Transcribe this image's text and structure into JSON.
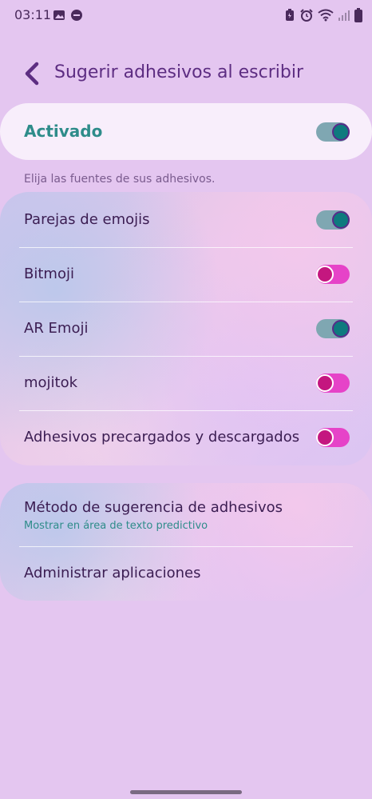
{
  "status_bar": {
    "time": "03:11"
  },
  "header": {
    "title": "Sugerir adhesivos al escribir"
  },
  "master": {
    "label": "Activado",
    "on": true
  },
  "section_hint": "Elija las fuentes de sus adhesivos.",
  "sources": [
    {
      "label": "Parejas de emojis",
      "on": true
    },
    {
      "label": "Bitmoji",
      "on": false
    },
    {
      "label": "AR Emoji",
      "on": true
    },
    {
      "label": "mojitok",
      "on": false
    },
    {
      "label": "Adhesivos precargados y descargados",
      "on": false
    }
  ],
  "settings": [
    {
      "label": "Método de sugerencia de adhesivos",
      "sub": "Mostrar en área de texto predictivo"
    },
    {
      "label": "Administrar aplicaciones"
    }
  ],
  "colors": {
    "background": "#e4c6f0",
    "accent_teal": "#2e8c8a",
    "title_purple": "#5d2d82",
    "toggle_off": "#e643c8"
  }
}
